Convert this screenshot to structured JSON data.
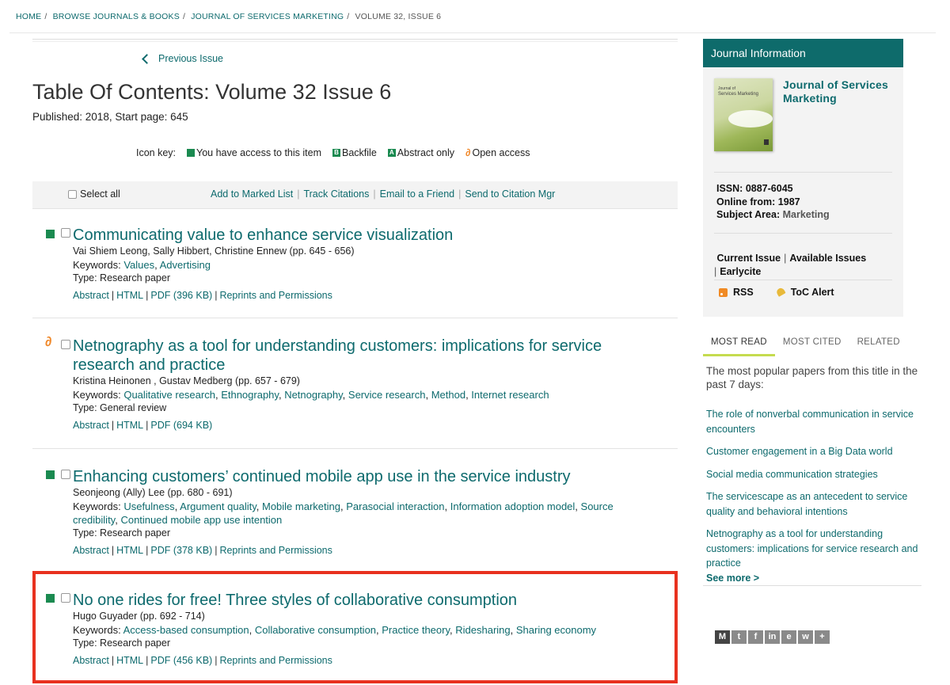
{
  "breadcrumb": {
    "home": "HOME",
    "browse": "BROWSE JOURNALS & BOOKS",
    "journal": "JOURNAL OF SERVICES MARKETING",
    "current": "VOLUME 32, ISSUE 6"
  },
  "nav": {
    "previous_issue": "Previous Issue"
  },
  "toc": {
    "title": "Table Of Contents: Volume 32 Issue 6",
    "published": "Published: 2018, Start page: 645"
  },
  "icon_key": {
    "label": "Icon key:",
    "access": "You have access to this item",
    "backfile": "Backfile",
    "backfile_letter": "B",
    "abstract_only": "Abstract only",
    "abstract_letter": "A",
    "open_access": "Open access"
  },
  "toolbar": {
    "select_all": "Select all",
    "add_marked": "Add to Marked List",
    "track": "Track Citations",
    "email": "Email to a Friend",
    "send": "Send to Citation Mgr"
  },
  "articles": [
    {
      "title": "Communicating value to enhance service visualization",
      "authors": "Vai Shiem Leong, Sally Hibbert, Christine Ennew (pp. 645 - 656)",
      "keywords_label": "Keywords:",
      "keywords": [
        "Values",
        "Advertising"
      ],
      "type": "Type: Research paper",
      "links": {
        "abstract": "Abstract",
        "html": "HTML",
        "pdf": "PDF (396 KB)",
        "reprints": "Reprints and Permissions"
      }
    },
    {
      "title": "Netnography as a tool for understanding customers: implications for service research and practice",
      "authors": "Kristina Heinonen , Gustav Medberg (pp. 657 - 679)",
      "keywords_label": "Keywords:",
      "keywords": [
        "Qualitative research",
        "Ethnography",
        "Netnography",
        "Service research",
        "Method",
        "Internet research"
      ],
      "type": "Type: General review",
      "links": {
        "abstract": "Abstract",
        "html": "HTML",
        "pdf": "PDF (694 KB)"
      }
    },
    {
      "title": "Enhancing customers’ continued mobile app use in the service industry",
      "authors": "Seonjeong (Ally) Lee (pp. 680 - 691)",
      "keywords_label": "Keywords:",
      "keywords": [
        "Usefulness",
        "Argument quality",
        "Mobile marketing",
        "Parasocial interaction",
        "Information adoption model",
        "Source credibility",
        "Continued mobile app use intention"
      ],
      "type": "Type: Research paper",
      "links": {
        "abstract": "Abstract",
        "html": "HTML",
        "pdf": "PDF (378 KB)",
        "reprints": "Reprints and Permissions"
      }
    },
    {
      "title": "No one rides for free! Three styles of collaborative consumption",
      "authors": "Hugo Guyader (pp. 692 - 714)",
      "keywords_label": "Keywords:",
      "keywords": [
        "Access-based consumption",
        "Collaborative consumption",
        "Practice theory",
        "Ridesharing",
        "Sharing economy"
      ],
      "type": "Type: Research paper",
      "links": {
        "abstract": "Abstract",
        "html": "HTML",
        "pdf": "PDF (456 KB)",
        "reprints": "Reprints and Permissions"
      }
    }
  ],
  "sidebar": {
    "header": "Journal Information",
    "journal_name": "Journal of Services Marketing",
    "cover_text_1": "Journal of",
    "cover_text_2": "Services Marketing",
    "issn_label": "ISSN:",
    "issn": "0887-6045",
    "online_label": "Online from:",
    "online": "1987",
    "subject_label": "Subject Area:",
    "subject": "Marketing",
    "current_issue": "Current Issue",
    "available_issues": "Available Issues",
    "earlycite": "Earlycite",
    "rss": "RSS",
    "toc_alert": "ToC Alert",
    "tabs": [
      "MOST READ",
      "MOST CITED",
      "RELATED"
    ],
    "intro": "The most popular papers from this title in the past 7 days:",
    "most_read": [
      "The role of nonverbal communication in service encounters",
      "Customer engagement in a Big Data world",
      "Social media communication strategies",
      "The servicescape as an antecedent to service quality and behavioral intentions",
      "Netnography as a tool for understanding customers: implications for service research and practice"
    ],
    "see_more": "See more >"
  },
  "share": {
    "icons": [
      "mendeley-icon",
      "twitter-icon",
      "facebook-icon",
      "linkedin-icon",
      "evernote-icon",
      "weibo-icon",
      "add-icon"
    ],
    "glyphs": [
      "M",
      "t",
      "f",
      "in",
      "e",
      "w",
      "+"
    ]
  }
}
